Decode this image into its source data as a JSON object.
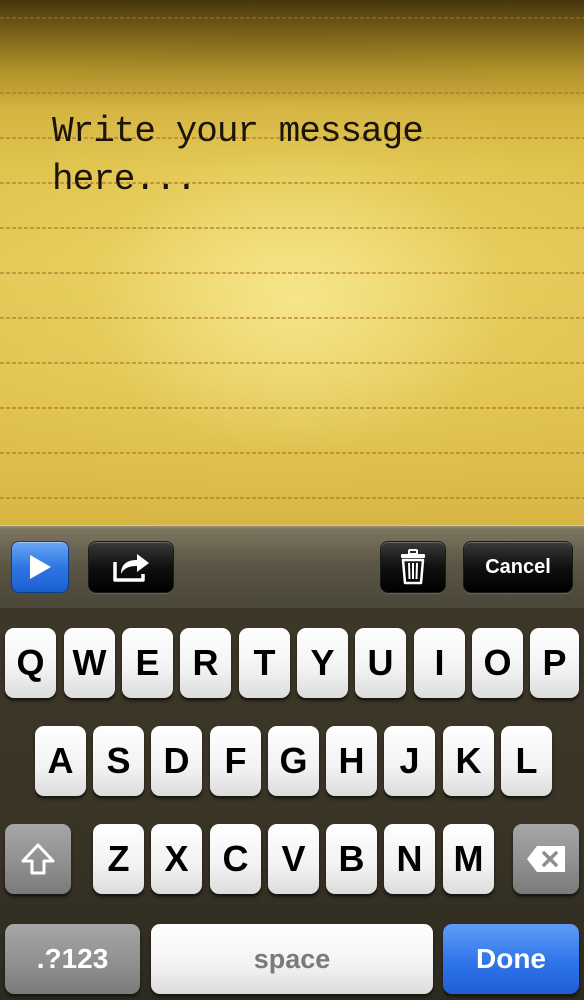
{
  "note": {
    "text": "Write your message\nhere..."
  },
  "toolbar": {
    "play_icon": "play-icon",
    "share_icon": "share-icon",
    "trash_icon": "trash-icon",
    "cancel_label": "Cancel",
    "colors": {
      "play_button": "#2f76e3",
      "dark_button": "#101010"
    }
  },
  "keyboard": {
    "row1": [
      "Q",
      "W",
      "E",
      "R",
      "T",
      "Y",
      "U",
      "I",
      "O",
      "P"
    ],
    "row2": [
      "A",
      "S",
      "D",
      "F",
      "G",
      "H",
      "J",
      "K",
      "L"
    ],
    "row3": [
      "Z",
      "X",
      "C",
      "V",
      "B",
      "N",
      "M"
    ],
    "shift_icon": "shift-icon",
    "delete_icon": "backspace-icon",
    "numbers_label": ".?123",
    "space_label": "space",
    "done_label": "Done",
    "colors": {
      "done_key": "#2f74ea",
      "key": "#f2f2f2",
      "modifier_key": "#8e8e8e"
    }
  }
}
